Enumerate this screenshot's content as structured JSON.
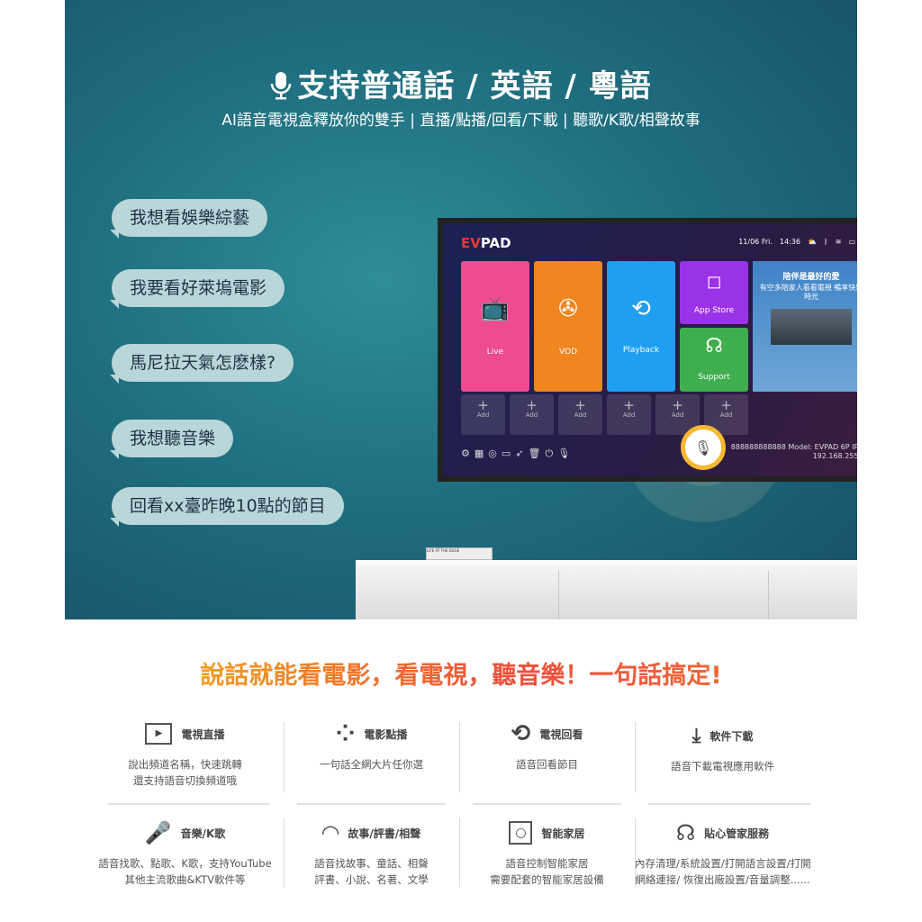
{
  "header": {
    "title": "支持普通話 / 英語 / 粵語",
    "subtitle": "AI語音電視盒釋放你的雙手 | 直播/點播/回看/下載 | 聽歌/K歌/相聲故事"
  },
  "bubbles": [
    "我想看娛樂綜藝",
    "我要看好萊塢電影",
    "馬尼拉天氣怎麽樣?",
    "我想聽音樂",
    "回看xx臺昨晚10點的節目"
  ],
  "tv": {
    "logo_ev": "EV",
    "logo_pad": "PAD",
    "date": "11/06 Fri.",
    "time": "14:36",
    "tiles": [
      {
        "label": "Live",
        "color": "#ef4b8f",
        "icon": "tv-icon"
      },
      {
        "label": "VOD",
        "color": "#f0861f",
        "icon": "film-reel-icon"
      },
      {
        "label": "Playback",
        "color": "#1e9ff0",
        "icon": "replay-icon"
      },
      {
        "label": "App Store",
        "color": "#9a32e8",
        "icon": "store-bag-icon"
      },
      {
        "label": "Support",
        "color": "#3fae4f",
        "icon": "headset-icon"
      }
    ],
    "add_label": "Add",
    "promo_title": "陪伴是最好的愛",
    "promo_sub": "有空多陪家人看看電視  暢享快樂時光",
    "info": "888888888888  Model: EVPAD 6P  IP: 192.168.255."
  },
  "book_text": "LIFE AT THE EDGE",
  "slogan": "說話就能看電影，看電視，聽音樂！一句話搞定!",
  "features": [
    {
      "title": "電視直播",
      "desc": [
        "說出頻道名稱，快速跳轉",
        "還支持語音切換頻道哦"
      ],
      "icon": "tv-play-icon"
    },
    {
      "title": "電影點播",
      "desc": [
        "一句話全網大片任你選"
      ],
      "icon": "film-reel-icon"
    },
    {
      "title": "電視回看",
      "desc": [
        "語音回看節目"
      ],
      "icon": "replay-icon"
    },
    {
      "title": "軟件下載",
      "desc": [
        "語音下載電視應用軟件"
      ],
      "icon": "download-icon"
    },
    {
      "title": "音樂/K歌",
      "desc": [
        "語音找歌、點歌、K歌，支持YouTube",
        "其他主流歌曲&KTV軟件等"
      ],
      "icon": "microphone-icon"
    },
    {
      "title": "故事/評書/相聲",
      "desc": [
        "語音找故事、童話、相聲",
        "評書、小說、名著、文學"
      ],
      "icon": "fan-icon"
    },
    {
      "title": "智能家居",
      "desc": [
        "語音控制智能家居",
        "需要配套的智能家居設備"
      ],
      "icon": "smart-switch-icon"
    },
    {
      "title": "貼心管家服務",
      "desc": [
        "內存清理/系統設置/打開語言設置/打開",
        "網絡連接/ 恢復出廠設置/音量調整......"
      ],
      "icon": "headset-icon"
    }
  ]
}
